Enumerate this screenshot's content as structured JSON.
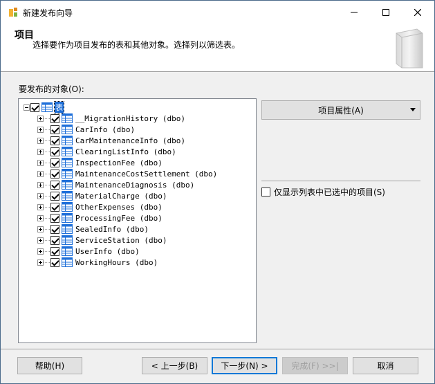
{
  "window": {
    "title": "新建发布向导"
  },
  "header": {
    "title": "项目",
    "description": "选择要作为项目发布的表和其他对象。选择列以筛选表。"
  },
  "objects": {
    "label": "要发布的对象(O):",
    "root_label": "表",
    "tables": [
      "__MigrationHistory (dbo)",
      "CarInfo (dbo)",
      "CarMaintenanceInfo (dbo)",
      "ClearingListInfo (dbo)",
      "InspectionFee (dbo)",
      "MaintenanceCostSettlement (dbo)",
      "MaintenanceDiagnosis (dbo)",
      "MaterialCharge (dbo)",
      "OtherExpenses (dbo)",
      "ProcessingFee (dbo)",
      "SealedInfo (dbo)",
      "ServiceStation (dbo)",
      "UserInfo (dbo)",
      "WorkingHours (dbo)"
    ]
  },
  "right_panel": {
    "properties_button": "项目属性(A)",
    "only_selected_label": "仅显示列表中已选中的项目(S)"
  },
  "footer": {
    "help": "帮助(H)",
    "back": "< 上一步(B)",
    "next": "下一步(N) >",
    "finish": "完成(F) >>|",
    "cancel": "取消"
  },
  "colors": {
    "accent": "#0078d7",
    "table_icon": "#1e6fd9"
  }
}
